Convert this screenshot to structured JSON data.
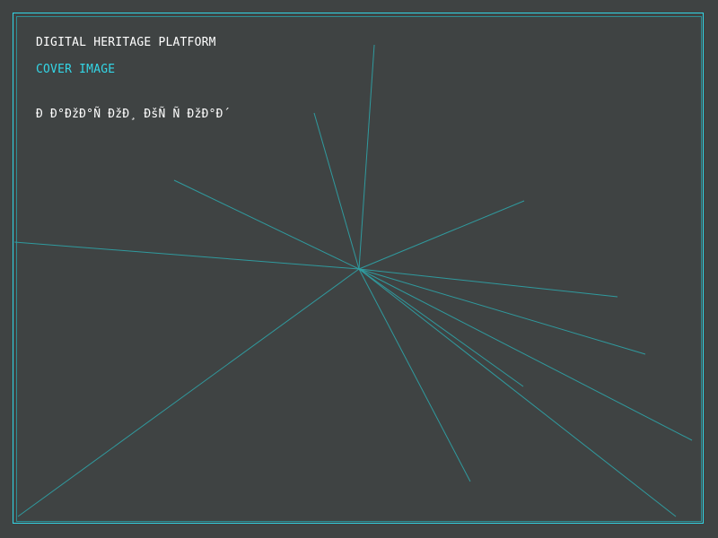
{
  "colors": {
    "background": "#3f4343",
    "accent": "#33d6e6",
    "ray": "#2f9fa3",
    "text": "#ffffff"
  },
  "header": {
    "title": "DIGITAL HERITAGE PLATFORM",
    "section_label": "COVER IMAGE",
    "garbled_text": "Ð Ð°ÐžÐ°Ñ ÐžÐ¸ ÐšÑ Ñ ÐžÐ°Ð´"
  }
}
